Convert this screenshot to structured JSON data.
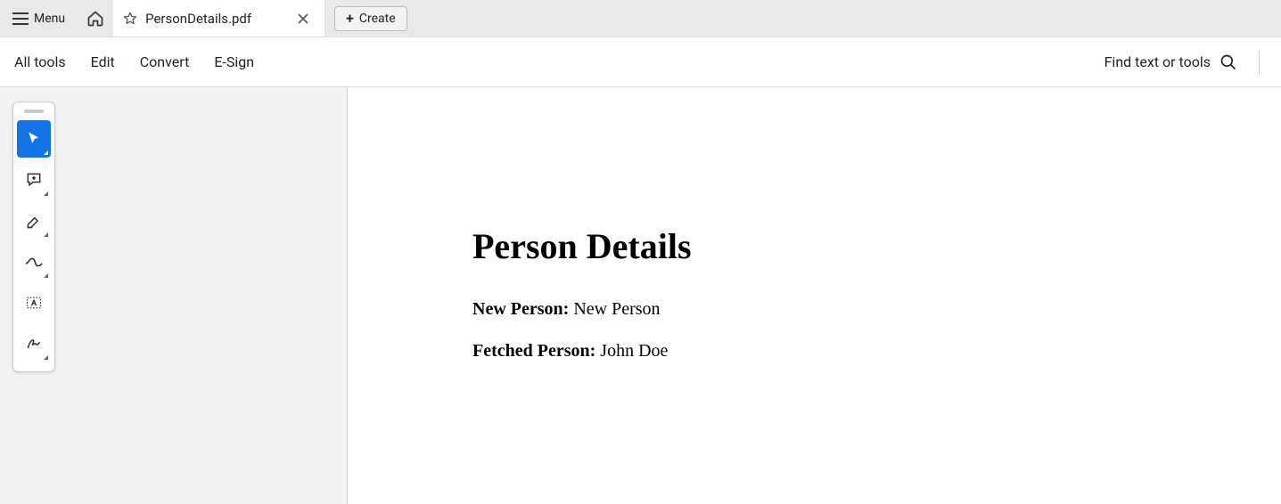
{
  "titlebar": {
    "menu_label": "Menu",
    "tab_title": "PersonDetails.pdf",
    "create_label": "Create"
  },
  "subtoolbar": {
    "items": [
      "All tools",
      "Edit",
      "Convert",
      "E-Sign"
    ],
    "find_label": "Find text or tools"
  },
  "tools": [
    {
      "name": "select-tool-icon",
      "active": true
    },
    {
      "name": "comment-tool-icon",
      "active": false
    },
    {
      "name": "highlight-tool-icon",
      "active": false
    },
    {
      "name": "draw-tool-icon",
      "active": false
    },
    {
      "name": "textbox-tool-icon",
      "active": false
    },
    {
      "name": "sign-tool-icon",
      "active": false
    }
  ],
  "document": {
    "heading": "Person Details",
    "rows": [
      {
        "label": "New Person:",
        "value": "New Person"
      },
      {
        "label": "Fetched Person:",
        "value": "John Doe"
      }
    ]
  }
}
